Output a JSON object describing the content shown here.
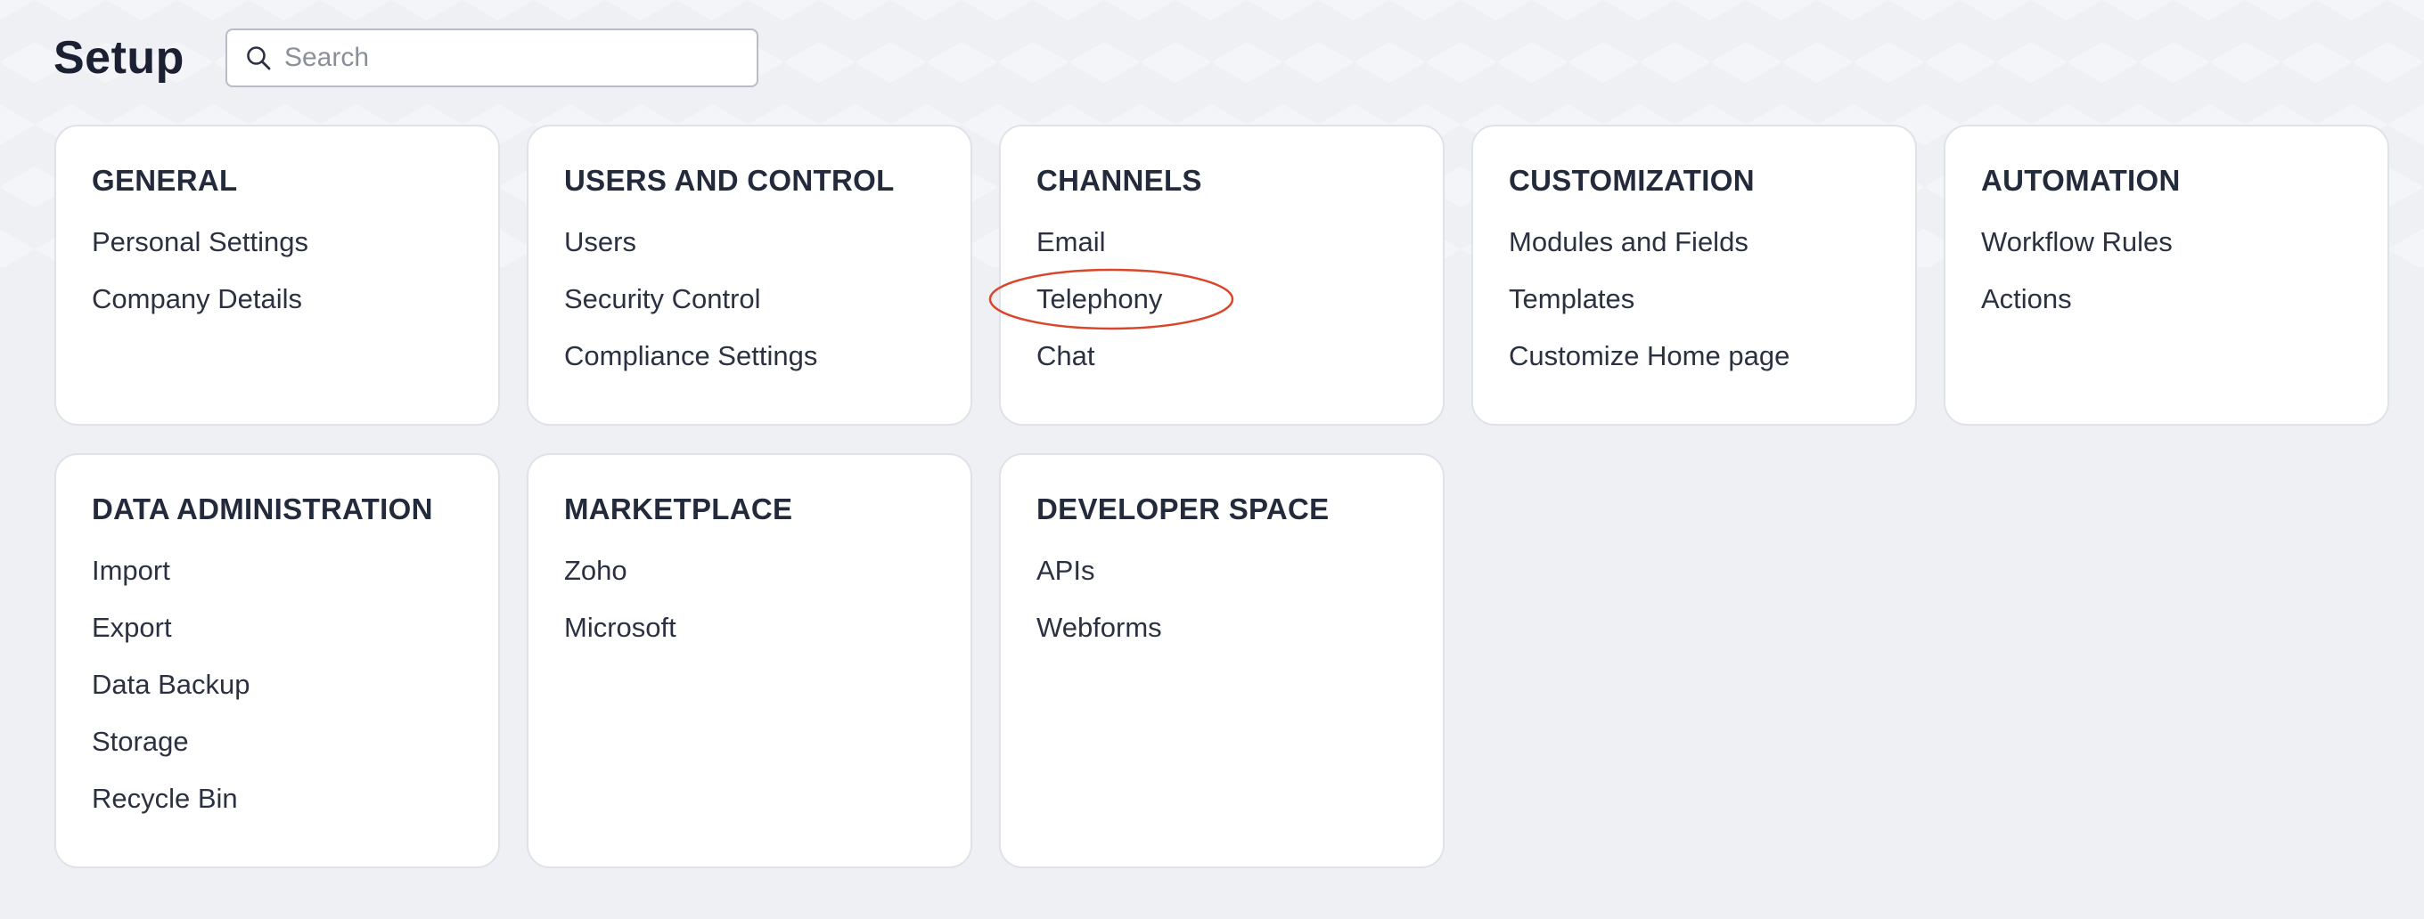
{
  "page": {
    "title": "Setup"
  },
  "search": {
    "placeholder": "Search",
    "value": ""
  },
  "highlight": {
    "target": "Telephony",
    "color": "#d9462b"
  },
  "cards": [
    {
      "title": "GENERAL",
      "items": [
        "Personal Settings",
        "Company Details"
      ]
    },
    {
      "title": "USERS AND CONTROL",
      "items": [
        "Users",
        "Security Control",
        "Compliance Settings"
      ]
    },
    {
      "title": "CHANNELS",
      "items": [
        "Email",
        "Telephony",
        "Chat"
      ]
    },
    {
      "title": "CUSTOMIZATION",
      "items": [
        "Modules and Fields",
        "Templates",
        "Customize Home page"
      ]
    },
    {
      "title": "AUTOMATION",
      "items": [
        "Workflow Rules",
        "Actions"
      ]
    },
    {
      "title": "DATA ADMINISTRATION",
      "items": [
        "Import",
        "Export",
        "Data Backup",
        "Storage",
        "Recycle Bin"
      ]
    },
    {
      "title": "MARKETPLACE",
      "items": [
        "Zoho",
        "Microsoft"
      ]
    },
    {
      "title": "DEVELOPER SPACE",
      "items": [
        "APIs",
        "Webforms"
      ]
    }
  ]
}
